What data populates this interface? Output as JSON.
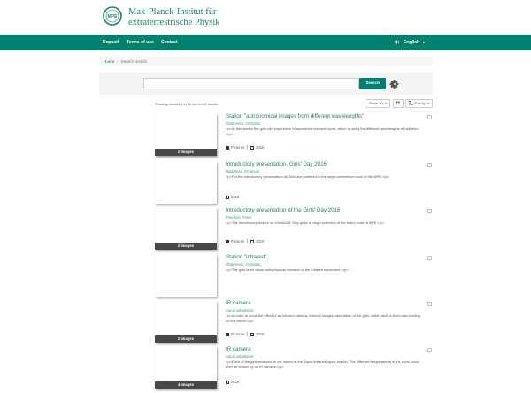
{
  "header": {
    "logo_text": "MPE",
    "institute_line1": "Max-Planck-Institut für",
    "institute_line2": "extraterrestrische Physik"
  },
  "nav": {
    "deposit": "Deposit",
    "terms": "Terms of use",
    "contact": "Contact",
    "language": "English"
  },
  "breadcrumb": {
    "home": "Home",
    "sep": "/",
    "current": "Search results"
  },
  "search": {
    "value": "",
    "placeholder": "",
    "button": "Search"
  },
  "results_info": "Showing records 1 to 10 out of 443 results.",
  "controls": {
    "show": "Show 10",
    "sort": "Sort by"
  },
  "results": [
    {
      "title": "Station \"astronomical images from different wavelengths\"",
      "author": "Obermeier, Christian",
      "description": "<p>At this station the girls can experience to reproduce research work, which is using the different wavelengths of radiation.</p>",
      "thumb_label": "2 images",
      "type": "Pictures",
      "year": "2016"
    },
    {
      "title": "Introductory presentation, Girls' Day 2016",
      "author": "Madarasz, Emanuel",
      "description": "<p>For the introductory presentation all Girls are gathered in the large conference room of the MPE.</p>",
      "thumb_label": "",
      "type": "",
      "year": "2016"
    },
    {
      "title": "Introductory presentation of the Girls' Day 2016",
      "author": "Friedrich, Peter",
      "description": "<p>The introductory lecture on Girls&#39; Day gives a rough overview of the entire work at MPE.</p>",
      "thumb_label": "2 images",
      "type": "Pictures",
      "year": "2016"
    },
    {
      "title": "Station \"infrared\"",
      "author": "Obermeier, Christian",
      "description": "<p>The girls learn about astrophysical research in the infrared waveband.</p>",
      "thumb_label": "",
      "type": "",
      "year": ""
    },
    {
      "title": "IR camera",
      "author": "Autor unbekannt",
      "description": "<p>In order to show the effect of an infrared camera, thermal images were taken of the girls, while each of them was holding an ice cream.</p>",
      "thumb_label": "2 images",
      "type": "Pictures",
      "year": "2016"
    },
    {
      "title": "IR camera",
      "author": "Autor unbekannt",
      "description": "<p>Each of the girls received an ice cream at the &quot;infrared&quot; station. The different temperatures in the room could then be shown by an IR camera.</p>",
      "thumb_label": "4 images",
      "type": "",
      "year": "2016"
    }
  ],
  "colors": {
    "brand_green": "#00806f",
    "link_green": "#1d7f70",
    "author_green": "#3aa07a"
  }
}
